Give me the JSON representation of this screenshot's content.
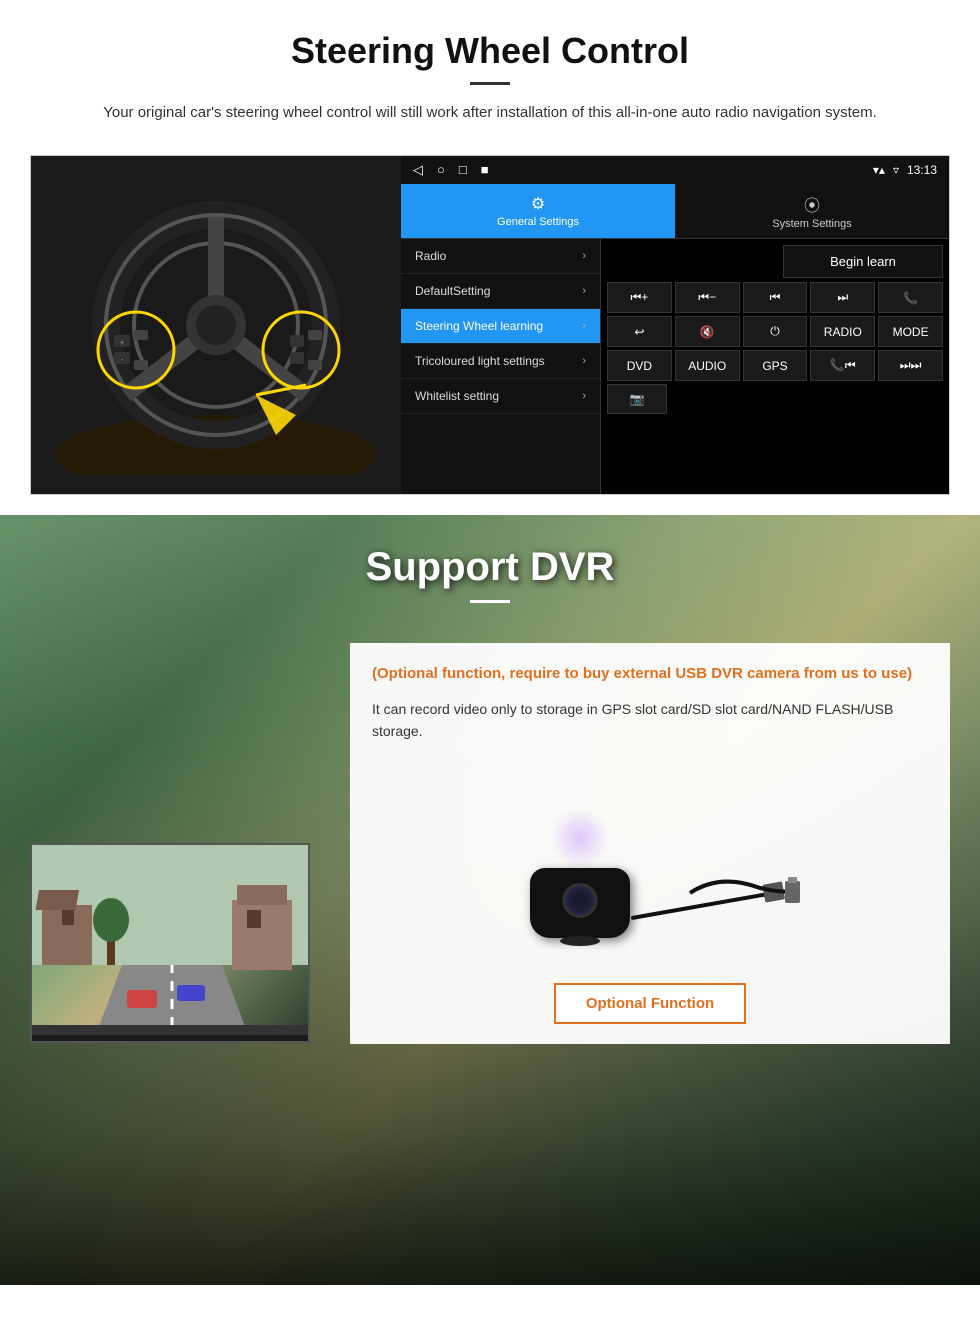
{
  "page": {
    "section1": {
      "title": "Steering Wheel Control",
      "description": "Your original car's steering wheel control will still work after installation of this all-in-one auto radio navigation system."
    },
    "section2": {
      "title": "Support DVR",
      "optional_text": "(Optional function, require to buy external USB DVR camera from us to use)",
      "description": "It can record video only to storage in GPS slot card/SD slot card/NAND FLASH/USB storage.",
      "optional_btn": "Optional Function"
    }
  },
  "android_ui": {
    "topbar": {
      "nav_icons": [
        "◁",
        "○",
        "□",
        "■"
      ],
      "time": "13:13"
    },
    "tabs": [
      {
        "label": "General Settings",
        "icon": "⚙",
        "active": true
      },
      {
        "label": "System Settings",
        "icon": "🌐",
        "active": false
      }
    ],
    "menu_items": [
      {
        "label": "Radio",
        "active": false
      },
      {
        "label": "DefaultSetting",
        "active": false
      },
      {
        "label": "Steering Wheel learning",
        "active": true
      },
      {
        "label": "Tricoloured light settings",
        "active": false
      },
      {
        "label": "Whitelist setting",
        "active": false
      }
    ],
    "begin_learn": "Begin learn",
    "control_buttons": [
      [
        "⏮+",
        "⏮-",
        "⏮",
        "⏭",
        "📞"
      ],
      [
        "↩",
        "🔇",
        "⏻",
        "RADIO",
        "MODE"
      ],
      [
        "DVD",
        "AUDIO",
        "GPS",
        "📞⏮",
        "⏭⏭"
      ],
      [
        "📷"
      ]
    ]
  }
}
